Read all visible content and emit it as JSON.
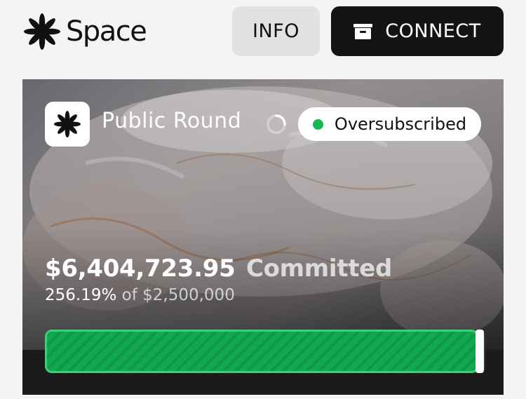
{
  "header": {
    "logo_text": "Space",
    "info_label": "INFO",
    "connect_label": "CONNECT"
  },
  "sale": {
    "round_label": "Public Round",
    "status": "Oversubscribed",
    "status_color": "#17b84f",
    "committed_amount": "$6,404,723.95",
    "committed_label": "Committed",
    "percent": "256.19%",
    "of_goal": "of $2,500,000",
    "progress_fraction": 1.0
  },
  "icons": {
    "logo": "asterisk-burst-icon",
    "connect": "wallet-icon",
    "round": "asterisk-burst-icon",
    "loading": "spinner-icon",
    "status": "green-dot-icon"
  }
}
